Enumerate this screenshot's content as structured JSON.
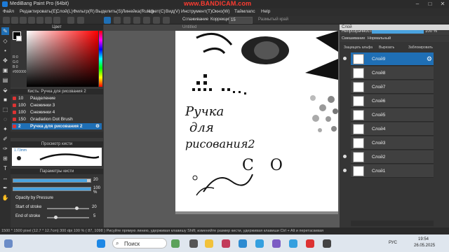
{
  "window": {
    "title": "MediBang Paint Pro (64bit)",
    "watermark": "www.BANDICAM.com"
  },
  "menu": [
    "Файл",
    "Редактировать(E)",
    "Слой(L)",
    "Фильтр(R)",
    "Выделить(S)",
    "Линейка(Ruler)",
    "Цвет(C)",
    "Вид(V)",
    "Инструмент(T)",
    "Окно(W)",
    "Таймлапс",
    "Help"
  ],
  "toolbar": {
    "smoothing_label": "Сглаживание",
    "correction_label": "Коррекция",
    "correction_value": "15",
    "range_label": "Размытый край"
  },
  "color_panel": {
    "title": "Цвет",
    "r": "R:0",
    "g": "G:0",
    "b": "B:0",
    "hex": "#000000"
  },
  "brush_panel": {
    "title": "Кисть: Ручка для рисования 2",
    "items": [
      {
        "size": "10",
        "name": "Разделение"
      },
      {
        "size": "100",
        "name": "Снежинки 3"
      },
      {
        "size": "100",
        "name": "Снежинки 4"
      },
      {
        "size": "150",
        "name": "Gradiation Dot Brush"
      },
      {
        "size": "2",
        "name": "Ручка для рисования 2"
      }
    ]
  },
  "preview_panel": {
    "title": "Просмотр кисти",
    "size_label": "1.73mm"
  },
  "params_panel": {
    "title": "Параметры кисти",
    "size_value": "20",
    "opacity_value": "100 %",
    "opacity_by_pressure": "Opacity by Pressure",
    "start_of_stroke": "Start of stroke",
    "start_value": "20",
    "end_of_stroke": "End of stroke",
    "end_value": "5",
    "size_fraction": 0.95,
    "opacity_fraction": 1.0
  },
  "canvas": {
    "tab_label": "Untitled",
    "handwriting": [
      "Ручка",
      "для",
      "рисования2"
    ],
    "extra": "С О"
  },
  "layers_panel": {
    "title": "Слой",
    "opacity_label": "Непрозрачность",
    "opacity_value": "100 %",
    "blend_label": "Смешивание",
    "blend_value": "Нормальный",
    "protect_alpha": "Защищать альфа",
    "clip": "Вырезать",
    "lock": "Заблокировать",
    "layers": [
      "Слой9",
      "Слой8",
      "Слой7",
      "Слой6",
      "Слой5",
      "Слой4",
      "Слой3",
      "Слой2",
      "Слой1"
    ]
  },
  "status": {
    "text": "1500 * 1500 pixel   (12.7 * 12.7cm)   300 dpi   100 %   ( 87, 1098 )   Рисуйте прямую линию, удерживая клавишу Shift; изменяйте размер кисти, удерживая клавиши Ctrl + Alt и перетаскивая"
  },
  "taskbar": {
    "search_placeholder": "Поиск",
    "lang": "РУС",
    "time": "19:54",
    "date": "26.05.2025"
  },
  "colors": {
    "accent": "#1f6fb5",
    "panel": "#353535"
  }
}
